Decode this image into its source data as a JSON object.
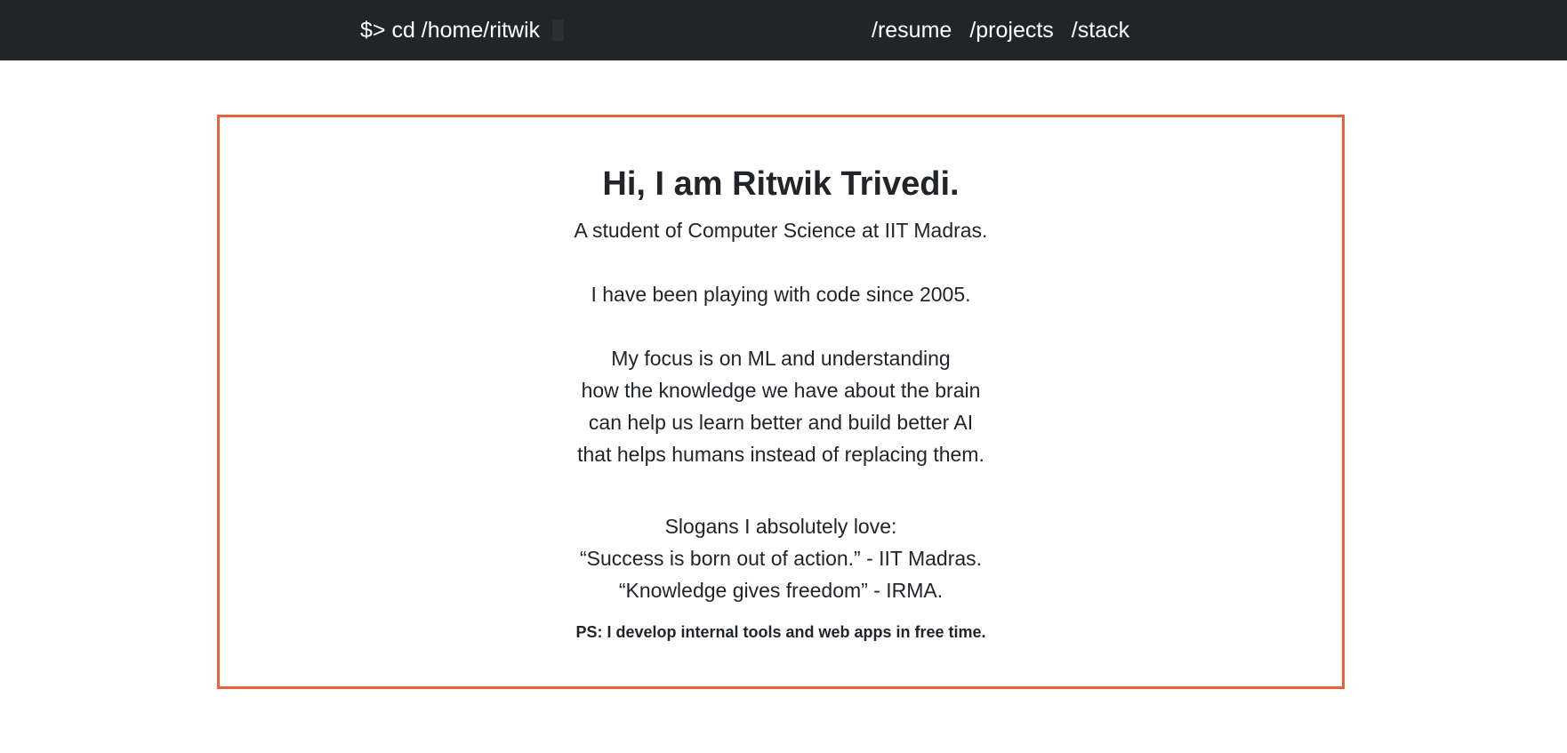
{
  "navbar": {
    "brand": "$> cd /home/ritwik",
    "links": [
      "/resume",
      "/projects",
      "/stack"
    ]
  },
  "intro": {
    "title": "Hi, I am Ritwik Trivedi.",
    "student": "A student of Computer Science at IIT Madras.",
    "coding": "I have been playing with code since 2005.",
    "focus": [
      "My focus is on ML and understanding",
      "how the knowledge we have about the brain",
      "can help us learn better and build better AI",
      "that helps humans instead of replacing them."
    ],
    "slogans_heading": "Slogans I absolutely love:",
    "slogans": [
      "“Success is born out of action.” - IIT Madras.",
      "“Knowledge gives freedom” - IRMA."
    ],
    "ps": "PS: I develop internal tools and web apps in free time."
  },
  "colors": {
    "navbar_bg": "#212529",
    "card_border": "#e8603c",
    "text": "#212529"
  }
}
